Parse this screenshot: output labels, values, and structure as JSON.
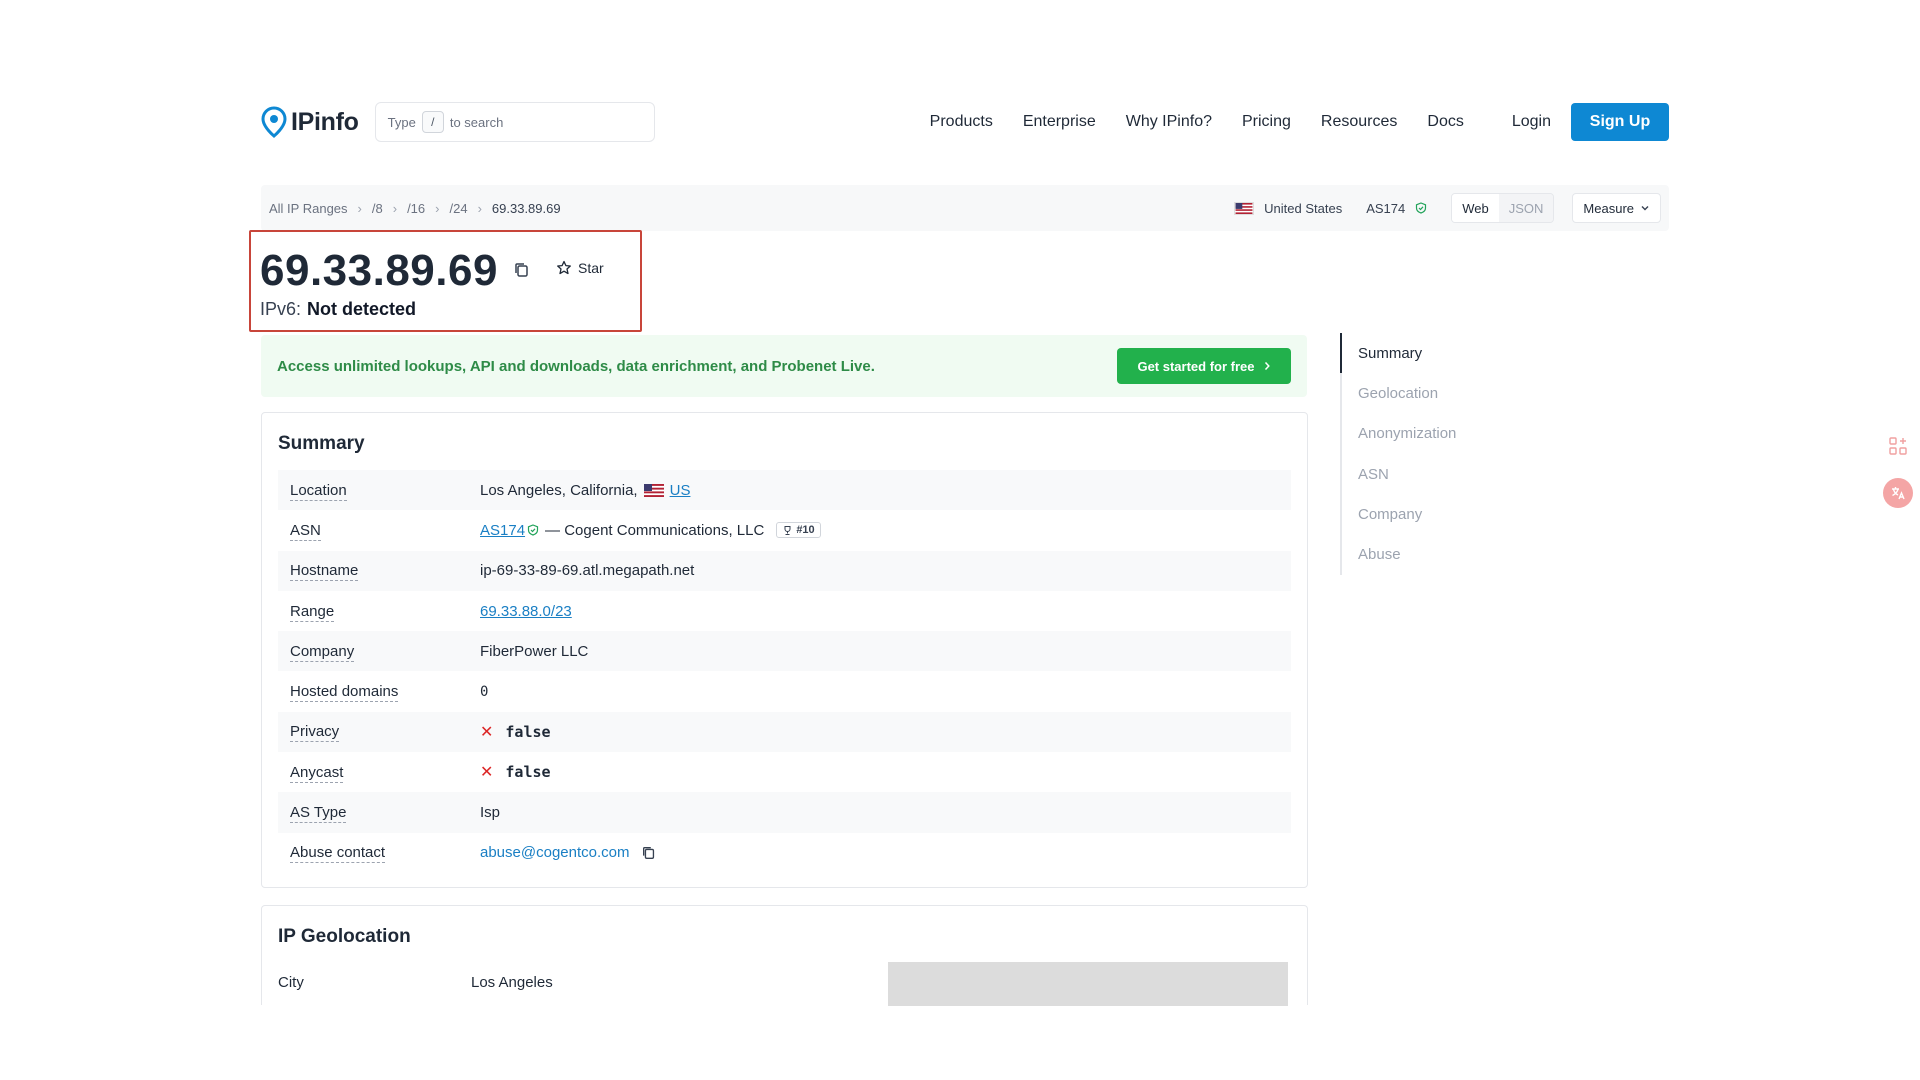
{
  "header": {
    "logo_text": "IPinfo",
    "search_prefix": "Type",
    "search_key": "/",
    "search_suffix": "to search",
    "nav": [
      "Products",
      "Enterprise",
      "Why IPinfo?",
      "Pricing",
      "Resources",
      "Docs"
    ],
    "login": "Login",
    "signup": "Sign Up"
  },
  "breadcrumb": {
    "items": [
      "All IP Ranges",
      "/8",
      "/16",
      "/24"
    ],
    "current": "69.33.89.69",
    "country": "United States",
    "asn": "AS174",
    "view_web": "Web",
    "view_json": "JSON",
    "measure": "Measure"
  },
  "ip": {
    "address": "69.33.89.69",
    "star_label": "Star",
    "ipv6_label": "IPv6:",
    "ipv6_value": "Not detected"
  },
  "promo": {
    "text": "Access unlimited lookups, API and downloads, data enrichment, and Probenet Live.",
    "button": "Get started for free"
  },
  "summary": {
    "title": "Summary",
    "location_label": "Location",
    "location_value": "Los Angeles, California,",
    "location_country": "US",
    "asn_label": "ASN",
    "asn_link": "AS174",
    "asn_name": "— Cogent Communications, LLC",
    "asn_rank": "#10",
    "hostname_label": "Hostname",
    "hostname_value": "ip-69-33-89-69.atl.megapath.net",
    "range_label": "Range",
    "range_value": "69.33.88.0/23",
    "company_label": "Company",
    "company_value": "FiberPower LLC",
    "hosted_label": "Hosted domains",
    "hosted_value": "0",
    "privacy_label": "Privacy",
    "privacy_value": "false",
    "anycast_label": "Anycast",
    "anycast_value": "false",
    "astype_label": "AS Type",
    "astype_value": "Isp",
    "abuse_label": "Abuse contact",
    "abuse_value": "abuse@cogentco.com"
  },
  "geolocation": {
    "title": "IP Geolocation",
    "city_label": "City",
    "city_value": "Los Angeles"
  },
  "toc": [
    "Summary",
    "Geolocation",
    "Anonymization",
    "ASN",
    "Company",
    "Abuse"
  ],
  "colors": {
    "accent": "#0e88d3",
    "promo_green": "#22b14c",
    "highlight_border": "#c8453a"
  }
}
